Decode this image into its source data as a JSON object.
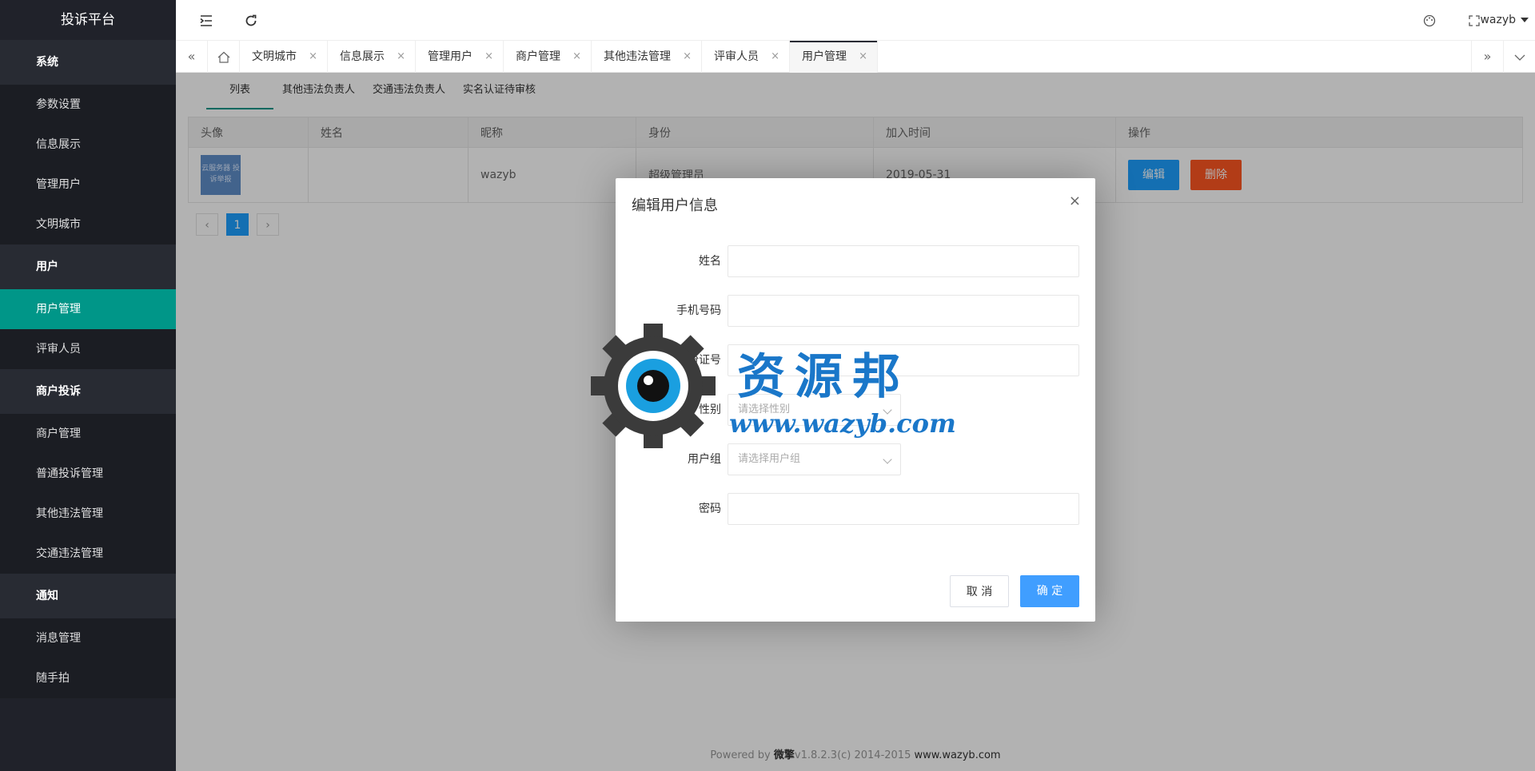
{
  "sidebar": {
    "logo": "投诉平台",
    "sections": [
      {
        "title": "系统",
        "items": [
          "参数设置",
          "信息展示",
          "管理用户",
          "文明城市"
        ]
      },
      {
        "title": "用户",
        "items": [
          "用户管理",
          "评审人员"
        ]
      },
      {
        "title": "商户投诉",
        "items": [
          "商户管理",
          "普通投诉管理",
          "其他违法管理",
          "交通违法管理"
        ]
      },
      {
        "title": "通知",
        "items": [
          "消息管理",
          "随手拍"
        ]
      }
    ],
    "active_item": "用户管理"
  },
  "header": {
    "user": "wazyb",
    "icons": [
      "menu-indent-icon",
      "refresh-icon",
      "palette-icon",
      "fullscreen-icon"
    ]
  },
  "tabs": {
    "items": [
      "文明城市",
      "信息展示",
      "管理用户",
      "商户管理",
      "其他违法管理",
      "评审人员",
      "用户管理"
    ],
    "active": "用户管理",
    "close": "×"
  },
  "content": {
    "subtabs": [
      "列表",
      "其他违法负责人",
      "交通违法负责人",
      "实名认证待审核"
    ],
    "active_subtab": "列表",
    "table": {
      "columns": [
        "头像",
        "姓名",
        "昵称",
        "身份",
        "加入时间",
        "操作"
      ],
      "rows": [
        {
          "avatar_text": "云服务器 投诉举报",
          "name": "",
          "nickname": "wazyb",
          "role": "超级管理员",
          "joined": "2019-05-31",
          "edit": "编辑",
          "delete": "删除"
        }
      ]
    },
    "pager": {
      "prev": "‹",
      "current": "1",
      "next": "›"
    },
    "footer": {
      "prefix": "Powered by ",
      "brand": "微擎",
      "version": "v1.8.2.3(c) 2014-2015 ",
      "site": "www.wazyb.com"
    }
  },
  "modal": {
    "title": "编辑用户信息",
    "close": "×",
    "fields": [
      {
        "label": "姓名",
        "value": "",
        "placeholder": ""
      },
      {
        "label": "手机号码",
        "value": "",
        "placeholder": ""
      },
      {
        "label": "身份证号",
        "value": "",
        "placeholder": ""
      },
      {
        "label": "性别",
        "value": "",
        "placeholder": "请选择性别"
      },
      {
        "label": "用户组",
        "value": "",
        "placeholder": "请选择用户组"
      },
      {
        "label": "密码",
        "value": "",
        "placeholder": ""
      }
    ],
    "cancel": "取 消",
    "ok": "确 定"
  },
  "watermark": {
    "title": "资源邦",
    "url": "www.wazyb.com"
  }
}
